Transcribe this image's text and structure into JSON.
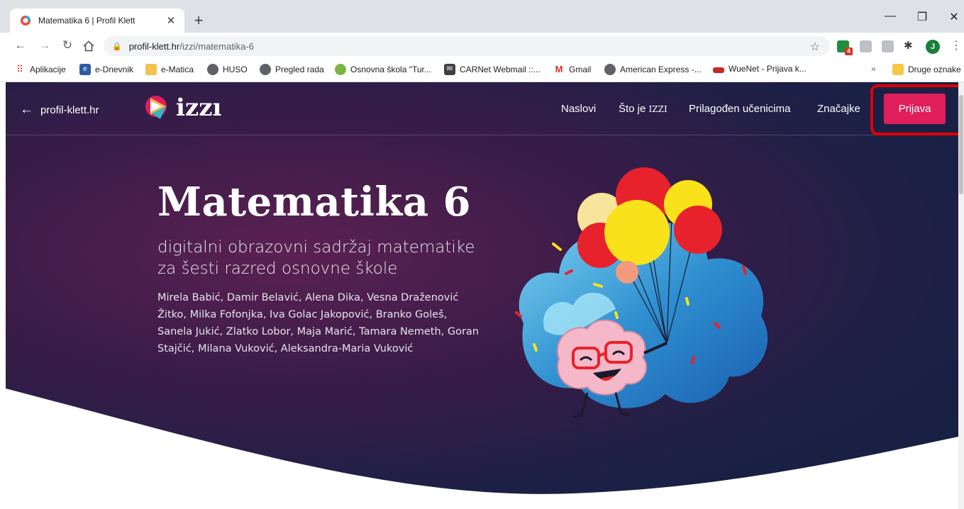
{
  "browser": {
    "tab": {
      "title": "Matematika 6 | Profil Klett"
    },
    "url": {
      "host": "profil-klett.hr",
      "path": "/izzi/matematika-6"
    },
    "extension_badge": "4",
    "profile_initial": "J",
    "bookmarks": [
      {
        "label": "Aplikacije",
        "icon": "apps-grid-icon"
      },
      {
        "label": "e-Dnevnik",
        "icon": "e-dnevnik-icon"
      },
      {
        "label": "e-Matica",
        "icon": "book-icon"
      },
      {
        "label": "HUSO",
        "icon": "globe-icon"
      },
      {
        "label": "Pregled rada",
        "icon": "globe-icon"
      },
      {
        "label": "Osnovna škola \"Tur...",
        "icon": "school-shield-icon"
      },
      {
        "label": "CARNet Webmail ::...",
        "icon": "mail-icon"
      },
      {
        "label": "Gmail",
        "icon": "gmail-icon"
      },
      {
        "label": "American Express -...",
        "icon": "globe-icon"
      },
      {
        "label": "WueNet - Prijava k...",
        "icon": "wuenet-icon"
      }
    ],
    "bookmarks_more": "»",
    "other_bookmarks": "Druge oznake"
  },
  "site": {
    "back_label": "profil-klett.hr",
    "logo_text": "izzı",
    "nav": {
      "naslovi": "Naslovi",
      "sto_je": "Što je",
      "sto_je_brand": "IZZI",
      "prilagoden": "Prilagođen učenicima",
      "znacajke": "Značajke",
      "prijava": "Prijava"
    }
  },
  "hero": {
    "title": "Matematika 6",
    "subtitle": "digitalni obrazovni sadržaj matematike za šesti razred osnovne škole",
    "authors": "Mirela Babić, Damir Belavić, Alena Dika, Vesna Draženović Žitko, Milka Fofonjka, Iva Golac Jakopović, Branko Goleš, Sanela Jukić, Zlatko Lobor, Maja Marić, Tamara Nemeth, Goran Stajčić, Milana Vuković, Aleksandra-Maria Vuković"
  },
  "colors": {
    "accent": "#e01e5a",
    "highlight": "#e00000",
    "hero_dark": "#1c2046",
    "hero_purple": "#5b2152"
  }
}
